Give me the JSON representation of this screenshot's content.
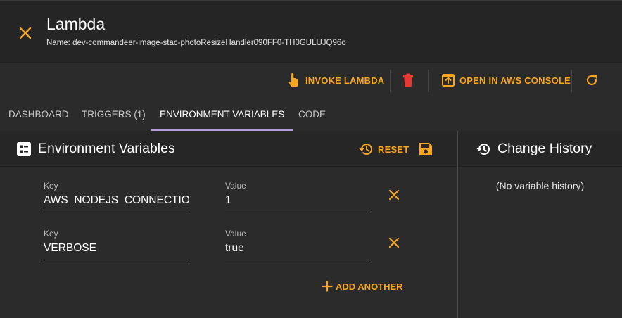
{
  "header": {
    "title": "Lambda",
    "subtitle": "Name: dev-commandeer-image-stac-photoResizeHandler090FF0-TH0GULUJQ96o"
  },
  "toolbar": {
    "invoke_label": "INVOKE LAMBDA",
    "open_console_label": "OPEN IN AWS CONSOLE"
  },
  "tabs": [
    {
      "label": "DASHBOARD"
    },
    {
      "label": "TRIGGERS (1)"
    },
    {
      "label": "ENVIRONMENT VARIABLES"
    },
    {
      "label": "CODE"
    }
  ],
  "env_panel": {
    "title": "Environment Variables",
    "reset_label": "RESET",
    "add_another_label": "ADD ANOTHER",
    "variables": [
      {
        "key_label": "Key",
        "key": "AWS_NODEJS_CONNECTION",
        "value_label": "Value",
        "value": "1"
      },
      {
        "key_label": "Key",
        "key": "VERBOSE",
        "value_label": "Value",
        "value": "true"
      }
    ]
  },
  "history_panel": {
    "title": "Change History",
    "empty_text": "(No variable history)"
  },
  "colors": {
    "accent": "#f5a623",
    "delete": "#e53935",
    "tab_indicator": "#b39ddb",
    "background": "#2b2b2b"
  },
  "icons": {
    "close": "close-icon",
    "invoke": "touch-icon",
    "delete": "trash-icon",
    "open_console": "open-in-new-icon",
    "refresh": "refresh-icon",
    "env_panel": "list-icon",
    "reset": "history-icon",
    "save": "save-icon",
    "remove": "close-icon",
    "add": "plus-icon",
    "history": "history-icon"
  }
}
